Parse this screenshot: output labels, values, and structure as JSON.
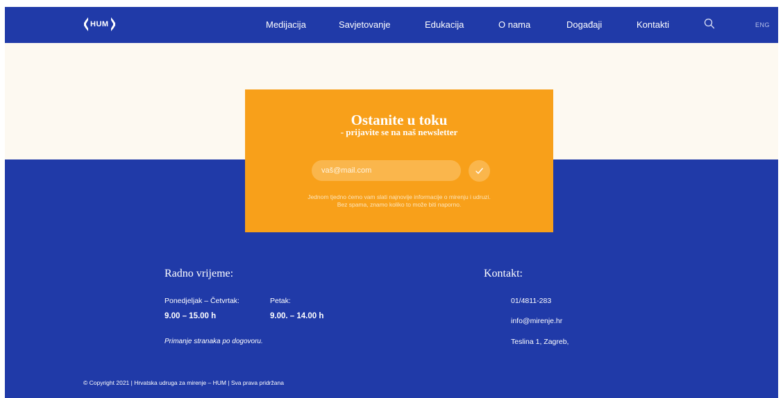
{
  "nav": {
    "logo_text": "HUM",
    "links": [
      "Medijacija",
      "Savjetovanje",
      "Edukacija",
      "O nama",
      "Događaji",
      "Kontakti"
    ],
    "search_icon": "search-icon",
    "language": "ENG"
  },
  "newsletter": {
    "title": "Ostanite u toku",
    "subtitle": "- prijavite se na naš newsletter",
    "email_placeholder": "vaš@mail.com",
    "submit_icon": "checkmark-icon",
    "note_line1": "Jednom tjedno ćemo vam slati najnovije informacije o mirenju i udruzi.",
    "note_line2": "Bez spama, znamo koliko to može biti naporno."
  },
  "hours": {
    "heading": "Radno vrijeme:",
    "weekday_label": "Ponedjeljak – Četvrtak:",
    "weekday_value": "9.00 – 15.00 h",
    "friday_label": "Petak:",
    "friday_value": "9.00. – 14.00 h",
    "note": "Primanje stranaka po dogovoru."
  },
  "contact": {
    "heading": "Kontakt:",
    "phone": "01/4811-283",
    "email": "info@mirenje.hr",
    "address": "Teslina 1, Zagreb,"
  },
  "footer": {
    "copyright": "© Copyright 2021 | Hrvatska udruga za mirenje – HUM | Sva prava pridržana"
  },
  "colors": {
    "brand_blue": "#203aa8",
    "accent_orange": "#f8a01a",
    "cream": "#fdf9f1"
  }
}
